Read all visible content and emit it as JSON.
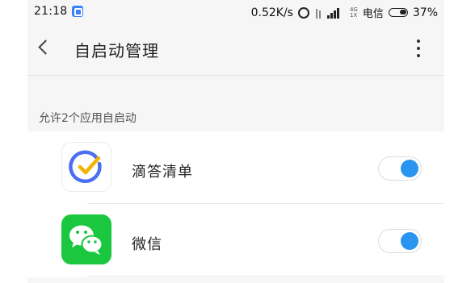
{
  "status_bar": {
    "time": "21:18",
    "net_speed": "0.52K/s",
    "network_top": "4G",
    "network_bottom": "1X",
    "carrier": "电信",
    "battery": "37%"
  },
  "header": {
    "title": "自启动管理"
  },
  "section": {
    "label": "允许2个应用自启动"
  },
  "apps": [
    {
      "name": "滴答清单",
      "icon": "ticktick-icon",
      "enabled": true
    },
    {
      "name": "微信",
      "icon": "wechat-icon",
      "enabled": true
    }
  ],
  "colors": {
    "toggle_accent": "#2a95f0",
    "wechat_green": "#1ac73f",
    "ticktick_blue": "#4b6ff0",
    "ticktick_yellow": "#f2b400"
  }
}
